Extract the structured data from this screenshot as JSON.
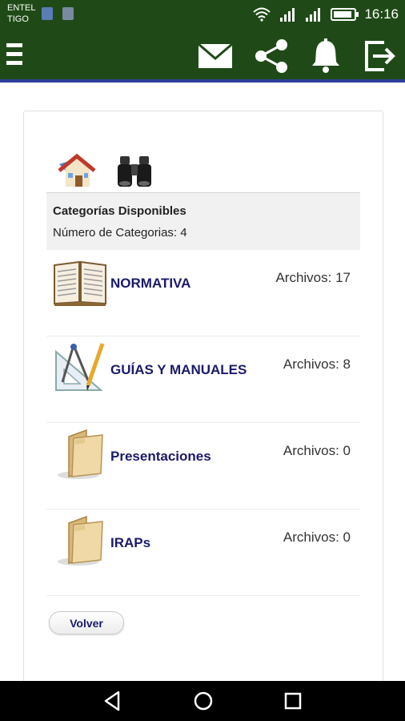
{
  "status_bar": {
    "carrier_line1": "ENTEL",
    "carrier_line2": "TIGO",
    "time": "16:16",
    "icons": [
      "sim-icon",
      "image-notification-icon",
      "wifi-icon",
      "signal-icon",
      "signal-icon",
      "battery-icon"
    ]
  },
  "app_bar": {
    "icons": [
      "menu-icon",
      "mail-icon",
      "share-icon",
      "bell-icon",
      "logout-icon"
    ]
  },
  "toolbar_icons": [
    "home-icon",
    "binoculars-icon"
  ],
  "info": {
    "title": "Categorías Disponibles",
    "count": "Número de Categorias: 4"
  },
  "categories": [
    {
      "name": "NORMATIVA",
      "files": "Archivos: 17",
      "icon": "book-icon"
    },
    {
      "name": "GUÍAS Y MANUALES",
      "files": "Archivos: 8",
      "icon": "drafting-tools-icon"
    },
    {
      "name": "Presentaciones",
      "files": "Archivos: 0",
      "icon": "folder-icon"
    },
    {
      "name": "IRAPs",
      "files": "Archivos: 0",
      "icon": "folder-icon"
    }
  ],
  "back_button": "Volver",
  "colors": {
    "app_bar": "#1f4a17",
    "app_bar_border": "#2f3f9a",
    "category_text": "#1a1a6b"
  },
  "nav_bar": {
    "icons": [
      "back-triangle-icon",
      "home-circle-icon",
      "recents-square-icon"
    ]
  }
}
